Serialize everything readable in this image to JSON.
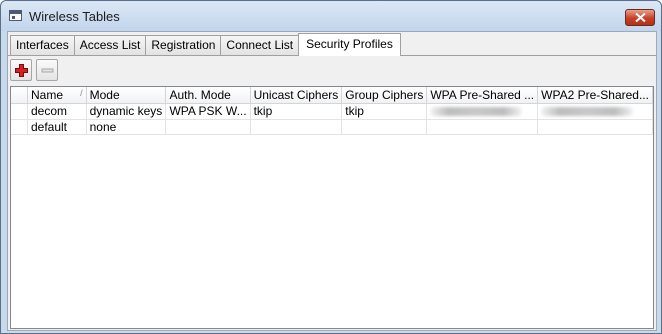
{
  "window": {
    "title": "Wireless Tables",
    "title_icon": "window-app-icon",
    "close_icon": "close-icon"
  },
  "tabs": [
    {
      "label": "Interfaces",
      "active": false
    },
    {
      "label": "Access List",
      "active": false
    },
    {
      "label": "Registration",
      "active": false
    },
    {
      "label": "Connect List",
      "active": false
    },
    {
      "label": "Security Profiles",
      "active": true
    }
  ],
  "toolbar": {
    "add_icon": "plus-icon",
    "remove_icon": "minus-icon",
    "add_color": "#d42020",
    "remove_enabled": false
  },
  "table": {
    "columns": [
      "Name",
      "Mode",
      "Auth. Mode",
      "Unicast Ciphers",
      "Group Ciphers",
      "WPA Pre-Shared ...",
      "WPA2 Pre-Shared..."
    ],
    "sort_column": "Name",
    "sort_indicator": "/",
    "rows": [
      {
        "name": "decom",
        "mode": "dynamic keys",
        "auth_mode": "WPA PSK W...",
        "unicast": "tkip",
        "group": "tkip",
        "wpa_psk_masked": true,
        "wpa2_psk_masked": true
      },
      {
        "name": "default",
        "mode": "none",
        "auth_mode": "",
        "unicast": "",
        "group": "",
        "wpa_psk_masked": false,
        "wpa2_psk_masked": false
      }
    ]
  }
}
